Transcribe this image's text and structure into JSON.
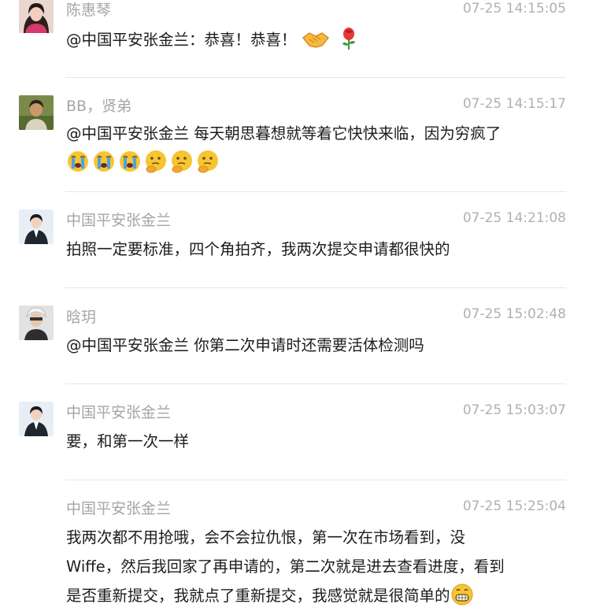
{
  "comments": [
    {
      "name": "陈惠琴",
      "time": "07-25 14:15:05",
      "text": "@中国平安张金兰：恭喜！恭喜！",
      "emojis": [
        "handshake-emoji",
        "rose-emoji"
      ]
    },
    {
      "name": "BB，贤弟",
      "time": "07-25 14:15:17",
      "text": "@中国平安张金兰 每天朝思暮想就等着它快快来临，因为穷疯了",
      "emojis": [
        "crying-emoji",
        "crying-emoji",
        "crying-emoji",
        "thinking-emoji",
        "thinking-emoji",
        "thinking-emoji"
      ]
    },
    {
      "name": "中国平安张金兰",
      "time": "07-25 14:21:08",
      "text": "拍照一定要标准，四个角拍齐，我两次提交申请都很快的"
    },
    {
      "name": "晗玥",
      "time": "07-25 15:02:48",
      "text": "@中国平安张金兰 你第二次申请时还需要活体检测吗"
    },
    {
      "name": "中国平安张金兰",
      "time": "07-25 15:03:07",
      "text": "要，和第一次一样"
    },
    {
      "name": "中国平安张金兰",
      "time": "07-25 15:25:04",
      "lines": [
        "我两次都不用抢哦，会不会拉仇恨，第一次在市场看到，没",
        "Wiffe，然后我回家了再申请的，第二次就是进去查看进度，看到",
        "是否重新提交，我就点了重新提交，我感觉就是很简单的"
      ],
      "emojis": [
        "grinning-emoji"
      ]
    }
  ]
}
